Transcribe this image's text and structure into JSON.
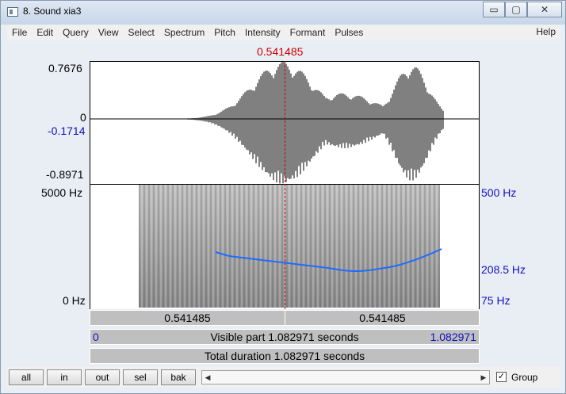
{
  "window": {
    "title": "8. Sound xia3",
    "minimize": "▭",
    "maximize": "▢",
    "close": "✕"
  },
  "menu": {
    "items": [
      "File",
      "Edit",
      "Query",
      "View",
      "Select",
      "Spectrum",
      "Pitch",
      "Intensity",
      "Formant",
      "Pulses"
    ],
    "help": "Help"
  },
  "waveform": {
    "cursor_time": "0.541485",
    "y_max": "0.7676",
    "y_zero": "0",
    "y_cursor": "-0.1714",
    "y_min": "-0.8971"
  },
  "spectrogram": {
    "freq_max": "5000 Hz",
    "freq_min": "0 Hz",
    "pitch_max": "500 Hz",
    "pitch_cursor": "208.5 Hz",
    "pitch_min": "75 Hz"
  },
  "time_bars": {
    "left_segment": "0.541485",
    "right_segment": "0.541485",
    "visible_start": "0",
    "visible_text": "Visible part 1.082971 seconds",
    "visible_end": "1.082971",
    "total_text": "Total duration 1.082971 seconds"
  },
  "buttons": {
    "all": "all",
    "in": "in",
    "out": "out",
    "sel": "sel",
    "bak": "bak"
  },
  "scroll": {
    "left": "◀",
    "right": "▶"
  },
  "group": {
    "checked": "✓",
    "label": "Group"
  },
  "colors": {
    "cursor": "#cc0000",
    "pitch": "#1010c0",
    "pitch_track": "#1e6cff"
  }
}
